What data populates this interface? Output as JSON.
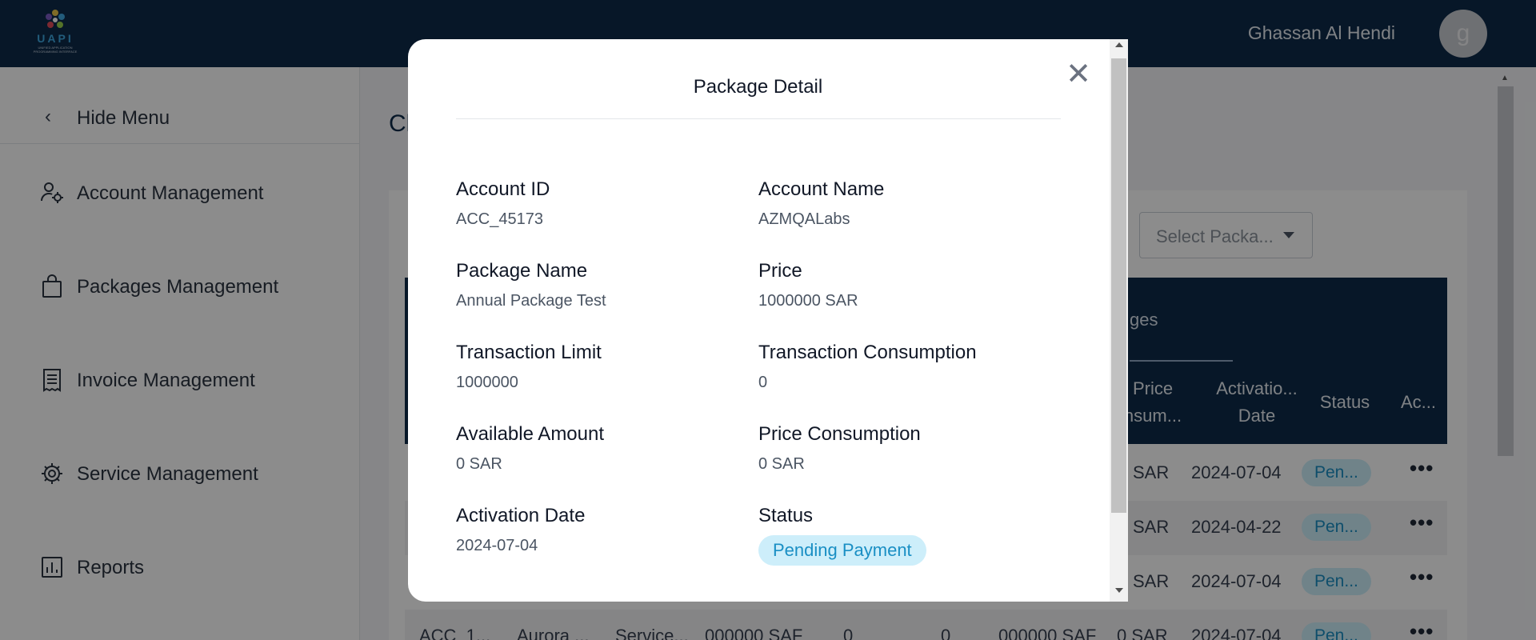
{
  "header": {
    "logo_text": "UAPI",
    "logo_subtext": "UNIFIED APPLICATION PROGRAMMING INTERFACE",
    "user_name": "Ghassan Al Hendi",
    "avatar_initial": "g"
  },
  "sidebar": {
    "hide_menu_label": "Hide Menu",
    "items": [
      {
        "label": "Account Management",
        "icon": "user-gear-icon"
      },
      {
        "label": "Packages Management",
        "icon": "shopping-bag-icon"
      },
      {
        "label": "Invoice Management",
        "icon": "receipt-icon"
      },
      {
        "label": "Service Management",
        "icon": "gear-icon"
      },
      {
        "label": "Reports",
        "icon": "bar-chart-icon"
      }
    ]
  },
  "main": {
    "title_fragment": "Cl",
    "select_package_placeholder": "Select Packa...",
    "tab_fragment": "ges",
    "columns": [
      {
        "line1": "Price",
        "line2": "nsum..."
      },
      {
        "line1": "Activatio...",
        "line2": "Date"
      },
      {
        "line1": "Status",
        "line2": ""
      },
      {
        "line1": "Ac...",
        "line2": ""
      }
    ],
    "rows": [
      {
        "price": "SAR",
        "date": "2024-07-04",
        "status": "Pen..."
      },
      {
        "price": "SAR",
        "date": "2024-04-22",
        "status": "Pen..."
      },
      {
        "price": "SAR",
        "date": "2024-07-04",
        "status": "Pen..."
      }
    ],
    "partial_row": [
      "ACC_1...",
      "Aurora ...",
      "Service...",
      "000000 SAF",
      "0",
      "0",
      "000000 SAF",
      "0 SAR",
      "2024-07-04",
      "Pen..."
    ]
  },
  "modal": {
    "title": "Package Detail",
    "fields": {
      "account_id": {
        "label": "Account ID",
        "value": "ACC_45173"
      },
      "account_name": {
        "label": "Account Name",
        "value": "AZMQALabs"
      },
      "package_name": {
        "label": "Package Name",
        "value": "Annual Package Test"
      },
      "price": {
        "label": "Price",
        "value": "1000000 SAR"
      },
      "transaction_limit": {
        "label": "Transaction Limit",
        "value": "1000000"
      },
      "transaction_consumption": {
        "label": "Transaction Consumption",
        "value": "0"
      },
      "available_amount": {
        "label": "Available Amount",
        "value": "0 SAR"
      },
      "price_consumption": {
        "label": "Price Consumption",
        "value": "0 SAR"
      },
      "activation_date": {
        "label": "Activation Date",
        "value": "2024-07-04"
      },
      "status": {
        "label": "Status",
        "value": "Pending Payment"
      }
    },
    "close_icon": "close-icon"
  },
  "colors": {
    "header_bg": "#0d2a4a",
    "status_pill_bg": "#cdeefa",
    "status_pill_text": "#1a8fc4"
  }
}
